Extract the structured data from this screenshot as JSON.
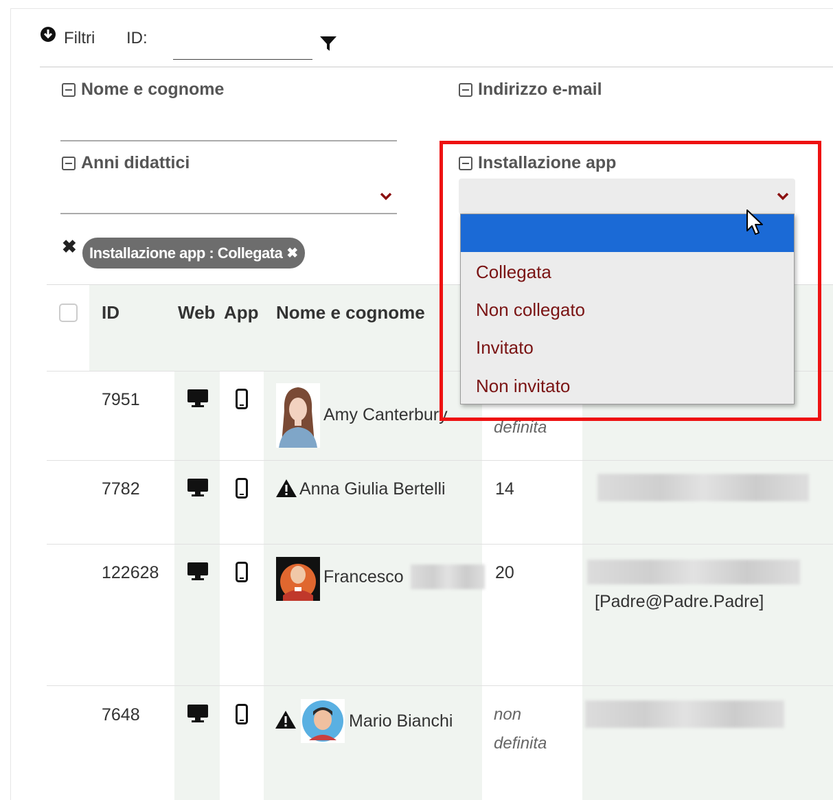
{
  "filters": {
    "toggle_label": "Filtri",
    "id_label": "ID:",
    "id_value": "",
    "fields": {
      "name": "Nome e cognome",
      "email": "Indirizzo e-mail",
      "years": "Anni didattici",
      "app_install": "Installazione app"
    },
    "active_chip": "Installazione app : Collegata",
    "app_install_options": [
      "",
      "Collegata",
      "Non collegato",
      "Invitato",
      "Non invitato"
    ]
  },
  "table": {
    "headers": {
      "id": "ID",
      "web": "Web",
      "app": "App",
      "name": "Nome e cognome"
    },
    "rows": [
      {
        "id": "7951",
        "name": "Amy Canterbury",
        "year": "definita",
        "email": "",
        "warning": false
      },
      {
        "id": "7782",
        "name": "Anna Giulia Bertelli",
        "year": "14",
        "email": "",
        "warning": true
      },
      {
        "id": "122628",
        "name": "Francesco",
        "year": "20",
        "email": "[Padre@Padre.Padre]",
        "warning": false
      },
      {
        "id": "7648",
        "name": "Mario Bianchi",
        "year": "non definita",
        "email": "",
        "warning": true
      }
    ]
  },
  "colors": {
    "highlight_border": "#ee1111",
    "option_text": "#7a1414",
    "selected_option": "#1b6ad6",
    "chip_bg": "#6d6d6d"
  },
  "icons": [
    "collapse-icon",
    "funnel-icon",
    "desktop-icon",
    "phone-icon",
    "warning-icon",
    "chevron-down-icon",
    "close-icon",
    "cursor-icon"
  ]
}
